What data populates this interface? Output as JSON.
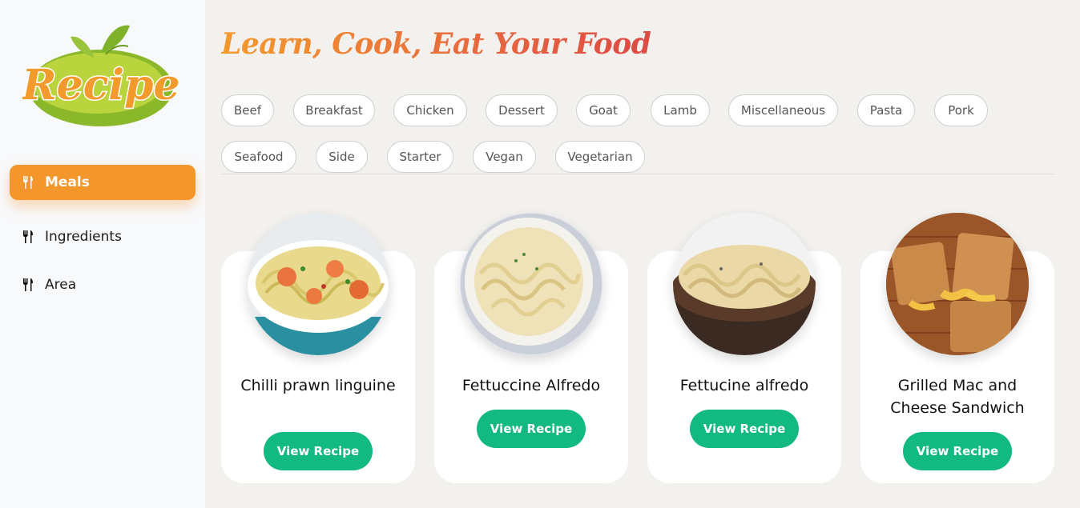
{
  "brand": {
    "logo_text": "Recipe"
  },
  "sidebar": {
    "items": [
      {
        "label": "Meals",
        "icon": "fork-knife-icon",
        "active": true
      },
      {
        "label": "Ingredients",
        "icon": "fork-knife-icon",
        "active": false
      },
      {
        "label": "Area",
        "icon": "fork-knife-icon",
        "active": false
      }
    ]
  },
  "main": {
    "headline": "Learn, Cook, Eat Your Food",
    "categories": [
      "Beef",
      "Breakfast",
      "Chicken",
      "Dessert",
      "Goat",
      "Lamb",
      "Miscellaneous",
      "Pasta",
      "Pork",
      "Seafood",
      "Side",
      "Starter",
      "Vegan",
      "Vegetarian"
    ],
    "meals": [
      {
        "title": "Chilli prawn linguine",
        "button": "View Recipe"
      },
      {
        "title": "Fettuccine Alfredo",
        "button": "View Recipe"
      },
      {
        "title": "Fettucine alfredo",
        "button": "View Recipe"
      },
      {
        "title": "Grilled Mac and Cheese Sandwich",
        "button": "View Recipe"
      }
    ]
  },
  "colors": {
    "accent": "#f3962b",
    "button": "#12b981",
    "headline_start": "#f39a2c",
    "headline_end": "#dd4a45"
  }
}
